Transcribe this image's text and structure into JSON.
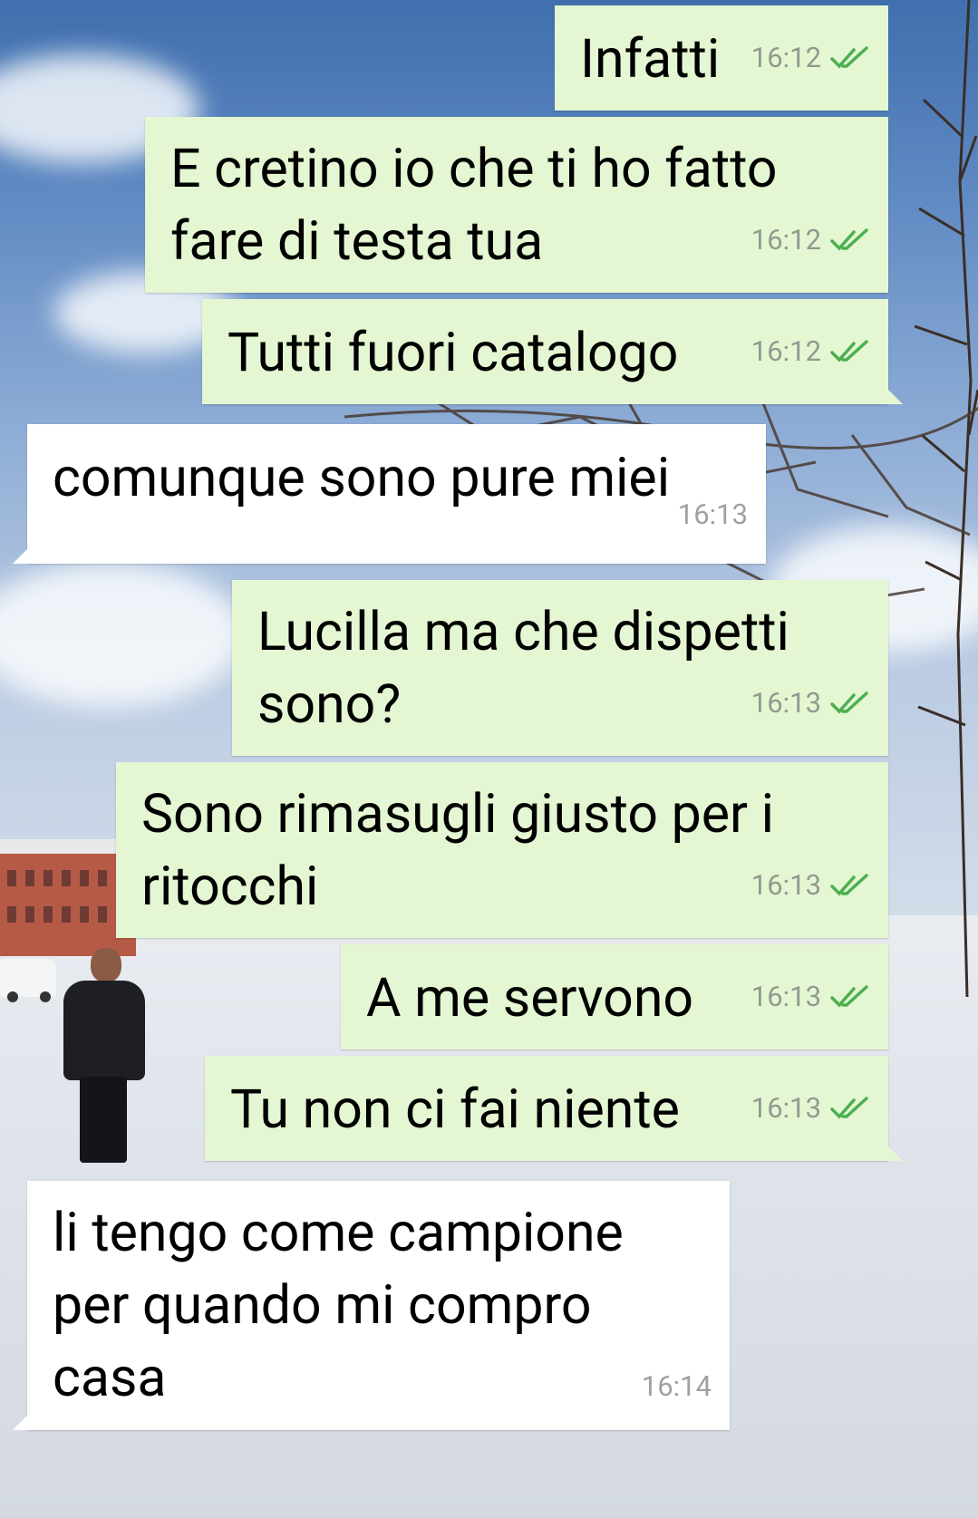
{
  "chat": {
    "messages": [
      {
        "direction": "out",
        "text": "Infatti",
        "time": "16:12",
        "status": "read"
      },
      {
        "direction": "out",
        "text": "E cretino io che ti ho fatto\nfare di testa tua",
        "time": "16:12",
        "status": "read"
      },
      {
        "direction": "out",
        "text": "Tutti fuori catalogo",
        "time": "16:12",
        "status": "read"
      },
      {
        "direction": "in",
        "text": "comunque sono pure miei",
        "time": "16:13"
      },
      {
        "direction": "out",
        "text": "Lucilla ma che dispetti\nsono?",
        "time": "16:13",
        "status": "read"
      },
      {
        "direction": "out",
        "text": "Sono rimasugli giusto per i\nritocchi",
        "time": "16:13",
        "status": "read"
      },
      {
        "direction": "out",
        "text": "A me servono",
        "time": "16:13",
        "status": "read"
      },
      {
        "direction": "out",
        "text": "Tu non ci fai niente",
        "time": "16:13",
        "status": "read"
      },
      {
        "direction": "in",
        "text": "li tengo come campione\nper quando mi compro\ncasa",
        "time": "16:14"
      }
    ]
  },
  "colors": {
    "outgoing_bubble": "#e4f7d2",
    "incoming_bubble": "#ffffff",
    "read_ticks": "#4caf50"
  },
  "icons": {
    "read_receipt": "double-check-icon"
  }
}
